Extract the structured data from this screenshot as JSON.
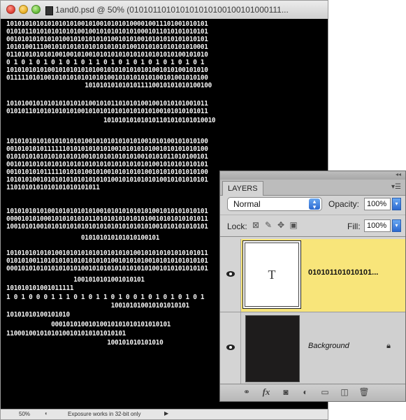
{
  "window": {
    "title": "1and0.psd @ 50% (010101101010101010100100101000111..."
  },
  "canvas": {
    "rows": [
      "101010101010101010100101001010101000010011101001010101",
      "010101101010101010100100101010101010001011010101010101",
      "001010101010101001010101010100101010010101010101010101",
      "101010011100101010101010101010101001010101010101010001",
      "011010101010100100101001010101010101010101010100101010",
      "0 1 0 1 0 1 0 1 0 1 0 1 1 0 1 0 1 0 1 0 1 0 1 0 1 0 1",
      "101010101010010101010101001010101010101001010100101010",
      "011111010100101010101010101001010101010100101001010100",
      "                     1010101010101011110010101010100100",
      "101010010101010101010100101011010101001001010101001011",
      "010101101010101010100101010101010101010100101010101011",
      "                          101010101010101101010101010010",
      "101010101010101010101001010101010101001010100101010100",
      "001010101011111101010101010100101010101001010101010100",
      "010101010101010101010010101010101010010101011010100101",
      "001010101010101010101010101010101010101001010101010101",
      "001010101011111010101001010010101010100101010101010100",
      "101010100101010101010101010100101010101010010101010101",
      "1101010101010101010101011",
      "101010101010010101010101001010101010101001010101010101",
      "000010101000101010101011010101010101010010101010101011",
      "100101010010101010101010101010101010101001010101010101",
      "                    010101010101010100101",
      "101010101010100101010101010101010100101010101010101011",
      "010101001101010101010101010100101010100101010101010101",
      "000101010101010101010010101010101010101001010101010101",
      "                  1001010101001010101",
      "101010101001011111",
      "1 0 1 0 0 0 1 1 1 0 1 0 1 1 0 1 0 0 1 0 1 0 1 0 1 0 1",
      "                            100101010010101010101",
      "10101010100101010",
      "            00010101001010010101010101010101",
      "11000100101010100101010101010101",
      "                           100101010101010"
    ]
  },
  "status_bar": {
    "zoom": "50%",
    "message": "Exposure works in 32-bit only",
    "arrow": "▶"
  },
  "layers_panel": {
    "tab_label": "LAYERS",
    "blend_mode": "Normal",
    "opacity_label": "Opacity:",
    "opacity_value": "100%",
    "lock_label": "Lock:",
    "fill_label": "Fill:",
    "fill_value": "100%",
    "layers": [
      {
        "name": "010101101010101...",
        "thumb_glyph": "T",
        "selected": true
      },
      {
        "name": "Background",
        "selected": false
      }
    ],
    "icons": {
      "link": "link-layers-icon",
      "fx": "layer-style-icon",
      "mask": "add-mask-icon",
      "adjust": "adjustment-layer-icon",
      "group": "new-group-icon",
      "new": "new-layer-icon",
      "delete": "trash-icon"
    },
    "fx_label": "fx"
  },
  "colors": {
    "selected_layer": "#f8e57a",
    "accent_blue": "#2b69d0",
    "canvas": "#000000"
  }
}
